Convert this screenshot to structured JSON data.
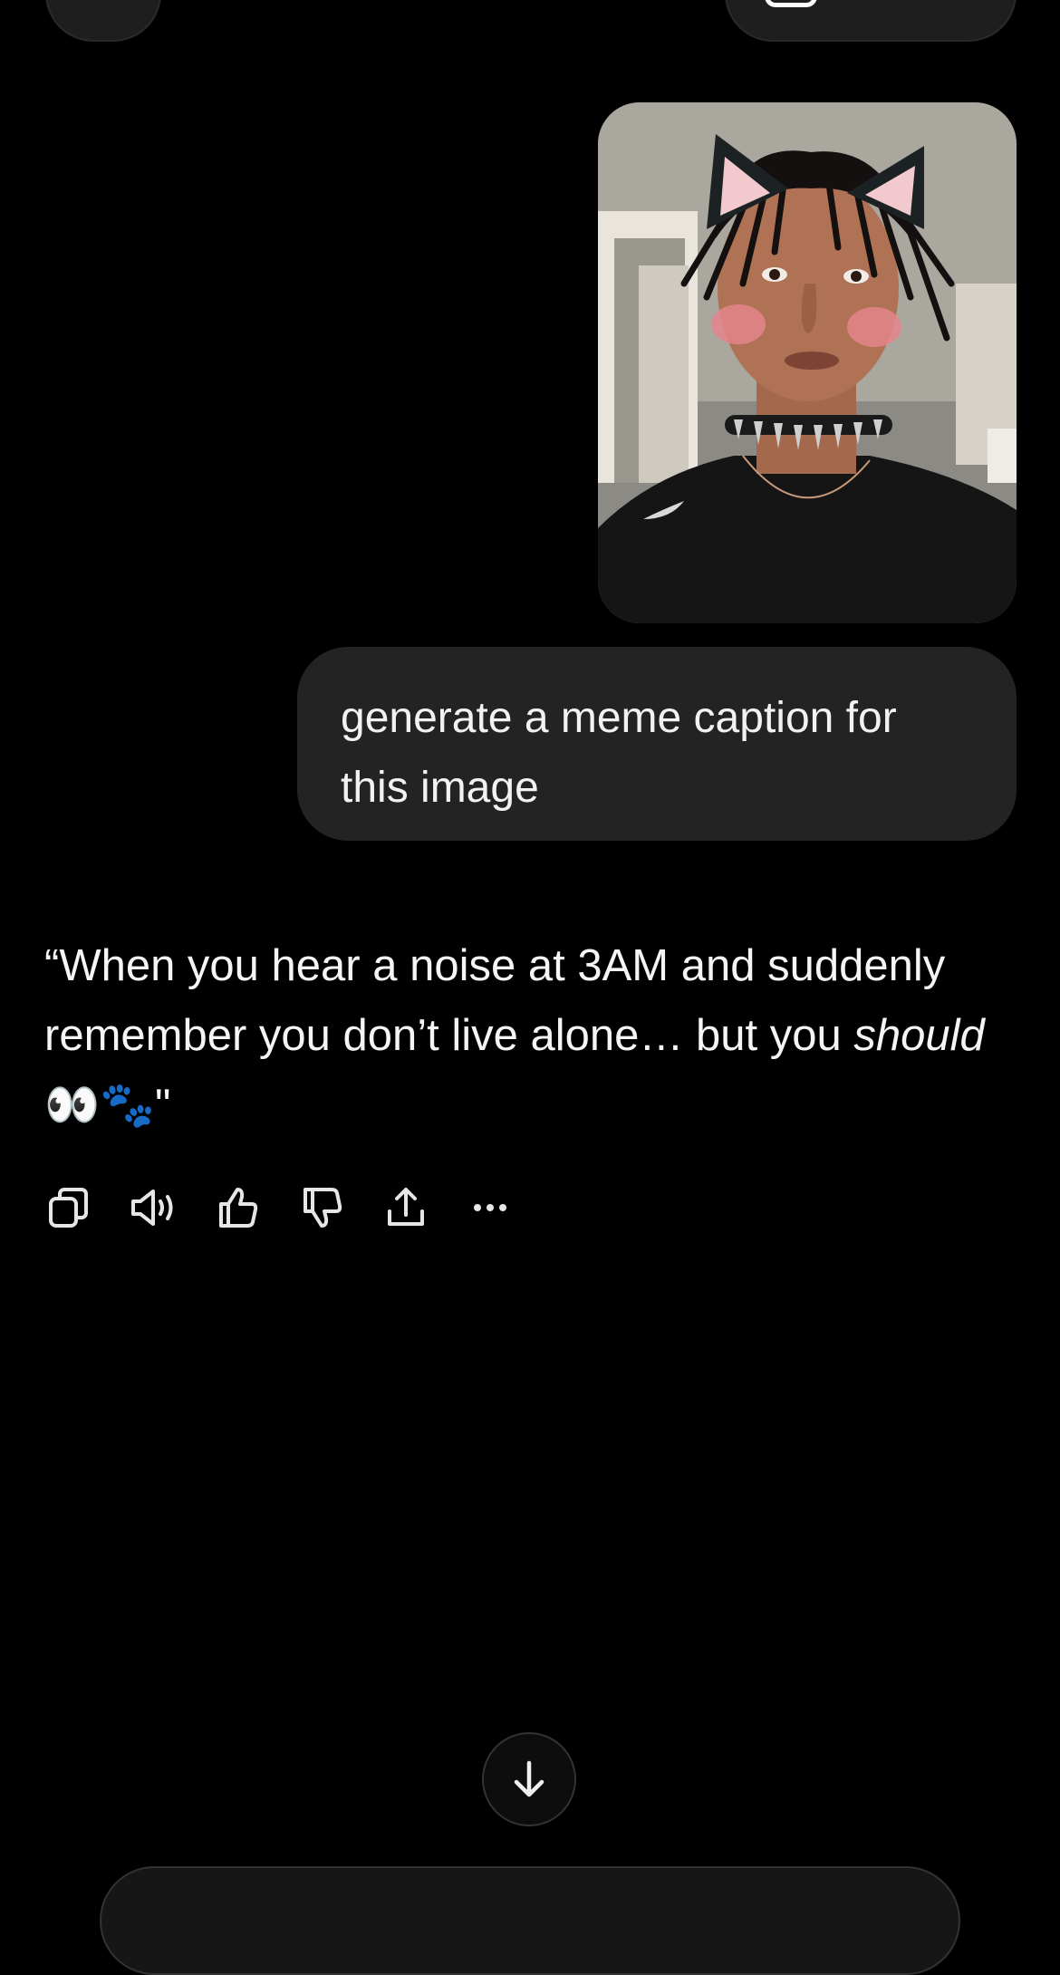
{
  "conversation": {
    "user_message": "generate a meme caption for this image",
    "assistant_reply": {
      "part1": "“When you hear a noise at 3AM and suddenly remember you don’t live alone… but you ",
      "emphasis": "should",
      "part2": " 👀🐾\""
    }
  },
  "actions": {
    "icons": [
      "copy-icon",
      "read-aloud-icon",
      "thumbs-up-icon",
      "thumbs-down-icon",
      "share-icon",
      "more-icon"
    ]
  },
  "colors": {
    "background": "#000000",
    "bubble": "#232323",
    "text": "#f5f5f5",
    "icon": "#e6e6e6"
  }
}
